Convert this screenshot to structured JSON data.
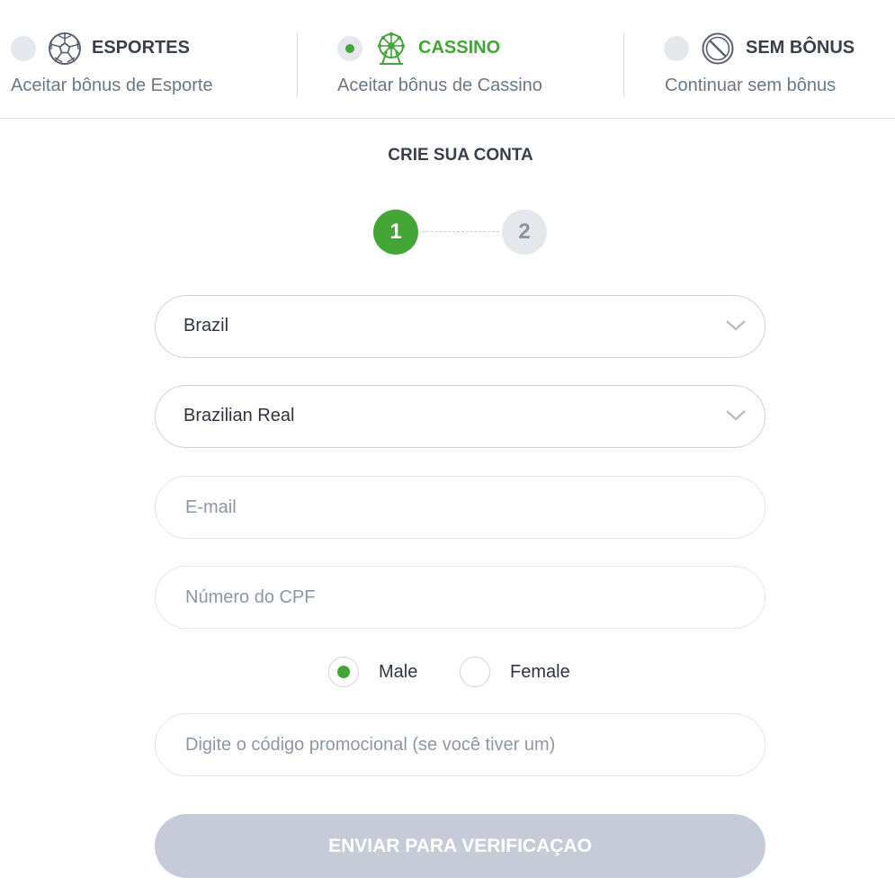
{
  "bonus_options": [
    {
      "title": "ESPORTES",
      "subtitle": "Aceitar bônus de Esporte",
      "icon": "soccer-ball-icon",
      "selected": false
    },
    {
      "title": "CASSINO",
      "subtitle": "Aceitar bônus de Cassino",
      "icon": "ferris-wheel-icon",
      "selected": true
    },
    {
      "title": "SEM BÔNUS",
      "subtitle": "Continuar sem bônus",
      "icon": "no-symbol-icon",
      "selected": false
    }
  ],
  "form": {
    "title": "CRIE SUA CONTA",
    "steps": [
      "1",
      "2"
    ],
    "current_step": 1,
    "country": "Brazil",
    "currency": "Brazilian Real",
    "email_placeholder": "E-mail",
    "cpf_placeholder": "Número do CPF",
    "gender": {
      "options": [
        "Male",
        "Female"
      ],
      "selected": "Male"
    },
    "promo_placeholder": "Digite o código promocional (se você tiver um)",
    "submit_label": "ENVIAR PARA VERIFICAÇAO"
  },
  "colors": {
    "accent": "#43a535",
    "disabled_button": "#c5ccd8",
    "muted_text": "#6b7785"
  }
}
